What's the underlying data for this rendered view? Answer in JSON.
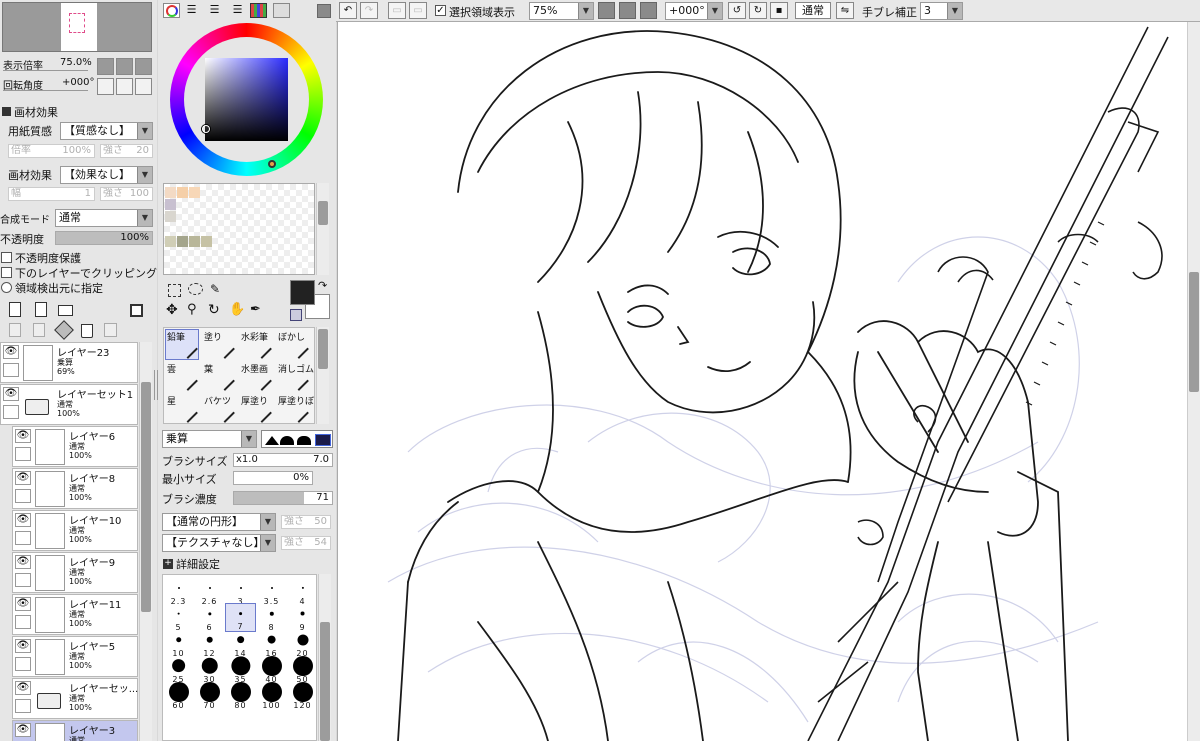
{
  "navigator": {
    "zoom_label": "表示倍率",
    "zoom_value": "75.0%",
    "rotation_label": "回転角度",
    "rotation_value": "+000°"
  },
  "paper_effects": {
    "section_title": "画材効果",
    "paper_texture_label": "用紙質感",
    "paper_texture_value": "【質感なし】",
    "scale_label": "倍率",
    "scale_value": "100%",
    "strength_label": "強さ",
    "strength_value": "20",
    "effect_label": "画材効果",
    "effect_value": "【効果なし】",
    "width_label": "幅",
    "width_value": "1",
    "effect_strength_value": "100"
  },
  "layer_props": {
    "blend_label": "合成モード",
    "blend_value": "通常",
    "opacity_label": "不透明度",
    "opacity_value": "100%",
    "opacity_level": 1.0,
    "preserve_opacity": "不透明度保護",
    "clip_below": "下のレイヤーでクリッピング",
    "selection_source": "領域検出元に指定"
  },
  "layers": [
    {
      "name": "レイヤー23",
      "mode": "乗算",
      "opacity": "69%",
      "selected": false,
      "folder": false,
      "indent": false
    },
    {
      "name": "レイヤーセット1",
      "mode": "通常",
      "opacity": "100%",
      "selected": false,
      "folder": true,
      "indent": false
    },
    {
      "name": "レイヤー6",
      "mode": "通常",
      "opacity": "100%",
      "selected": false,
      "folder": false,
      "indent": true
    },
    {
      "name": "レイヤー8",
      "mode": "通常",
      "opacity": "100%",
      "selected": false,
      "folder": false,
      "indent": true
    },
    {
      "name": "レイヤー10",
      "mode": "通常",
      "opacity": "100%",
      "selected": false,
      "folder": false,
      "indent": true
    },
    {
      "name": "レイヤー9",
      "mode": "通常",
      "opacity": "100%",
      "selected": false,
      "folder": false,
      "indent": true
    },
    {
      "name": "レイヤー11",
      "mode": "通常",
      "opacity": "100%",
      "selected": false,
      "folder": false,
      "indent": true
    },
    {
      "name": "レイヤー5",
      "mode": "通常",
      "opacity": "100%",
      "selected": false,
      "folder": false,
      "indent": true
    },
    {
      "name": "レイヤーセッ...",
      "mode": "通常",
      "opacity": "100%",
      "selected": false,
      "folder": true,
      "indent": true
    },
    {
      "name": "レイヤー3",
      "mode": "通常",
      "opacity": "",
      "selected": true,
      "folder": false,
      "indent": true
    }
  ],
  "tools": [
    {
      "label": "鉛筆",
      "selected": true
    },
    {
      "label": "塗り",
      "selected": false
    },
    {
      "label": "水彩筆",
      "selected": false
    },
    {
      "label": "ぼかし",
      "selected": false
    },
    {
      "label": "雲",
      "selected": false
    },
    {
      "label": "葉",
      "selected": false
    },
    {
      "label": "水墨画",
      "selected": false
    },
    {
      "label": "消しゴム",
      "selected": false
    },
    {
      "label": "星",
      "selected": false
    },
    {
      "label": "バケツ",
      "selected": false
    },
    {
      "label": "厚塗り",
      "selected": false
    },
    {
      "label": "厚塗りぼ",
      "selected": false
    }
  ],
  "brush": {
    "blend_value": "乗算",
    "size_label": "ブラシサイズ",
    "size_mult": "x1.0",
    "size_value": "7.0",
    "min_size_label": "最小サイズ",
    "min_size_value": "0%",
    "density_label": "ブラシ濃度",
    "density_value": "71",
    "density_level": 0.71,
    "shape_value": "【通常の円形】",
    "shape_strength": "50",
    "texture_value": "【テクスチャなし】",
    "texture_strength": "54",
    "advanced_label": "詳細設定",
    "sizes": [
      [
        "2.3",
        "2.6",
        "3",
        "3.5",
        "4"
      ],
      [
        "5",
        "6",
        "7",
        "8",
        "9"
      ],
      [
        "10",
        "12",
        "14",
        "16",
        "20"
      ],
      [
        "25",
        "30",
        "35",
        "40",
        "50"
      ],
      [
        "60",
        "70",
        "80",
        "100",
        "120"
      ]
    ],
    "selected_size": "7"
  },
  "toolbar": {
    "selection_display_label": "選択領域表示",
    "zoom_value": "75%",
    "rotation_value": "+000°",
    "blend_value": "通常",
    "stabilizer_label": "手ブレ補正",
    "stabilizer_value": "3"
  },
  "colors": {
    "current_fg": "#222222",
    "current_bg": "#ffffff",
    "swatches": [
      "#f3dac4",
      "#f5cfa8",
      "#f7d7b7",
      "#c8c0d0",
      "#d9d6cf",
      "#a4a58c",
      "#b8b699",
      "#c6c2a5",
      "#d0ceb6"
    ]
  }
}
